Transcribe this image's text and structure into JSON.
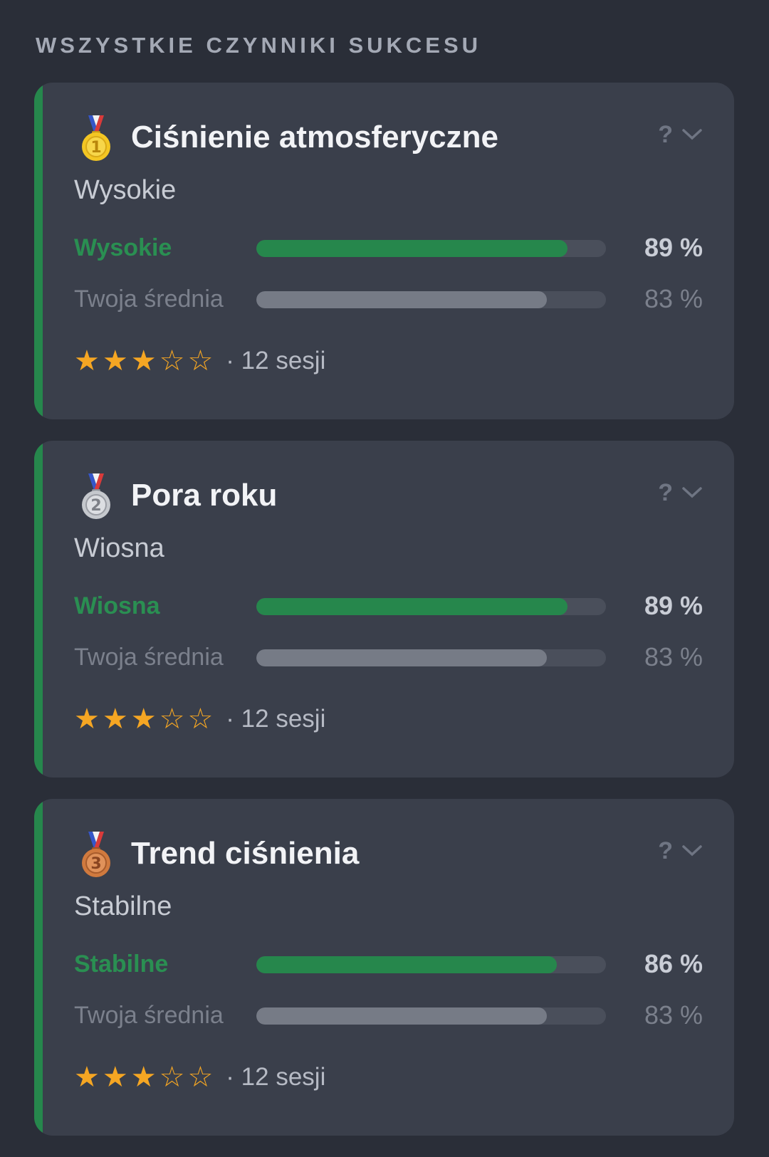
{
  "section_title": "WSZYSTKIE CZYNNIKI SUKCESU",
  "colors": {
    "background": "#2a2e38",
    "card": "#3a3f4b",
    "accent_green": "#26874c",
    "star": "#f5a623",
    "gold": "#f3c623",
    "silver": "#c5c8cd",
    "bronze": "#d07a3e"
  },
  "cards": [
    {
      "medal": "gold-medal-1",
      "medal_number": "1",
      "title": "Ciśnienie atmosferyczne",
      "value": "Wysokie",
      "help": "?",
      "rows": [
        {
          "label": "Wysokie",
          "percent_text": "89 %",
          "percent": 89
        },
        {
          "label": "Twoja średnia",
          "percent_text": "83 %",
          "percent": 83
        }
      ],
      "rating": 3,
      "rating_max": 5,
      "sessions": "· 12 sesji"
    },
    {
      "medal": "silver-medal-2",
      "medal_number": "2",
      "title": "Pora roku",
      "value": "Wiosna",
      "help": "?",
      "rows": [
        {
          "label": "Wiosna",
          "percent_text": "89 %",
          "percent": 89
        },
        {
          "label": "Twoja średnia",
          "percent_text": "83 %",
          "percent": 83
        }
      ],
      "rating": 3,
      "rating_max": 5,
      "sessions": "· 12 sesji"
    },
    {
      "medal": "bronze-medal-3",
      "medal_number": "3",
      "title": "Trend ciśnienia",
      "value": "Stabilne",
      "help": "?",
      "rows": [
        {
          "label": "Stabilne",
          "percent_text": "86 %",
          "percent": 86
        },
        {
          "label": "Twoja średnia",
          "percent_text": "83 %",
          "percent": 83
        }
      ],
      "rating": 3,
      "rating_max": 5,
      "sessions": "· 12 sesji"
    }
  ]
}
